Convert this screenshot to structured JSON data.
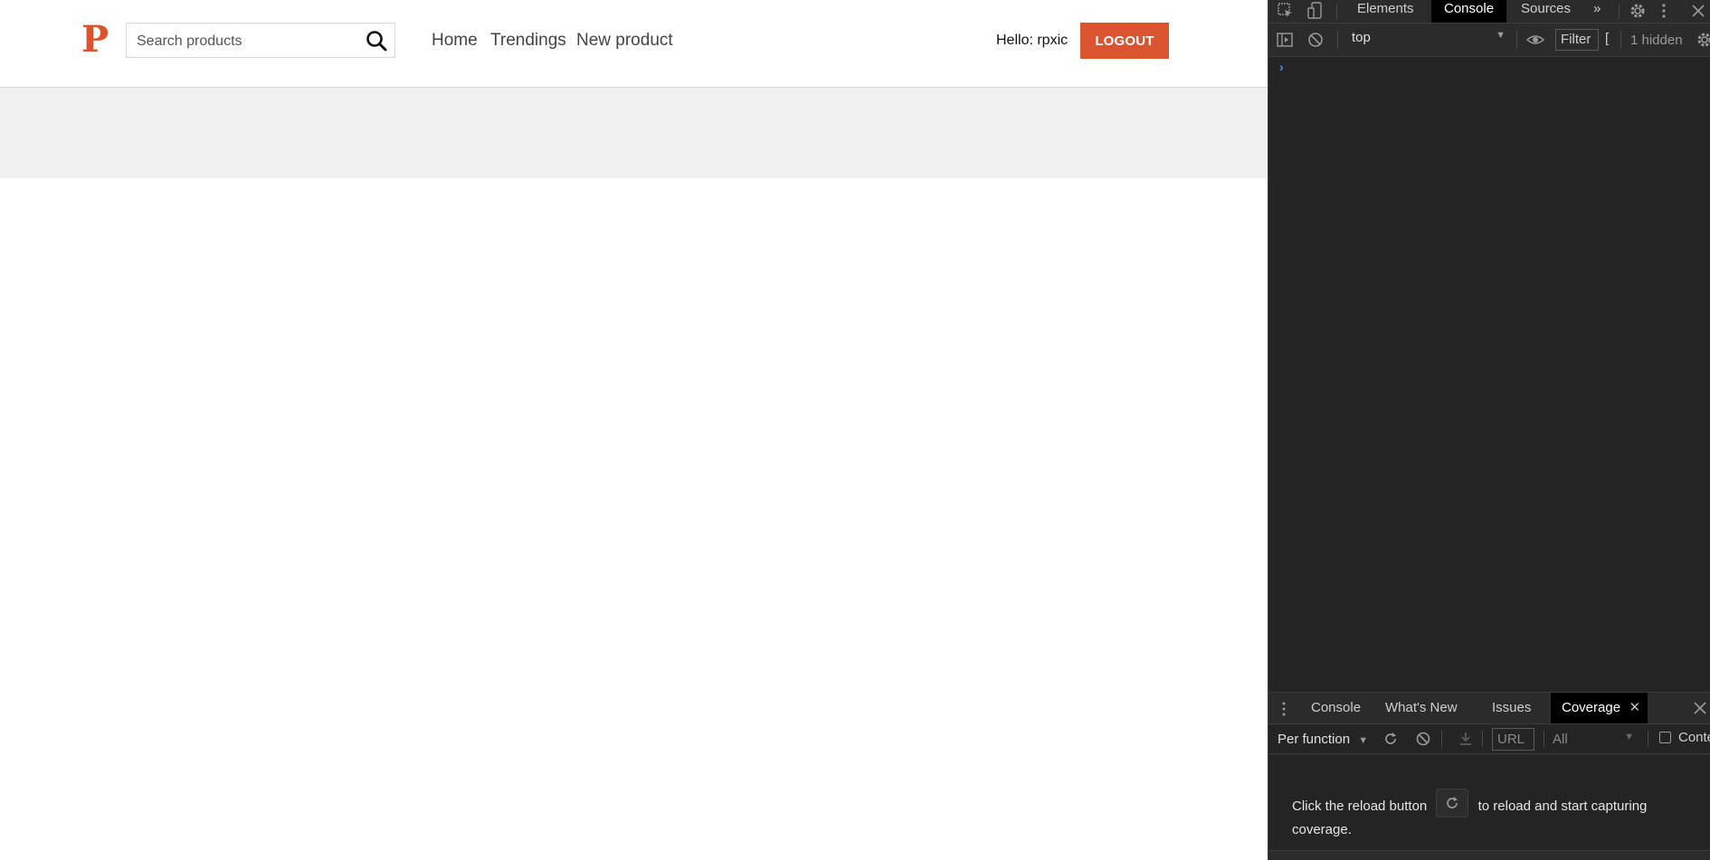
{
  "header": {
    "logo_letter": "P",
    "search_placeholder": "Search products",
    "nav": [
      "Home",
      "Trendings",
      "New product"
    ],
    "greeting": "Hello: rpxic",
    "logout_label": "LOGOUT"
  },
  "colors": {
    "brand": "#da552f",
    "banner": "#f0f0f0",
    "devtools_bg": "#242424"
  },
  "devtools": {
    "tabs": [
      "Elements",
      "Console",
      "Sources"
    ],
    "active_tab": "Console",
    "more_tabs_glyph": "»",
    "context": "top",
    "filter_label": "Filter",
    "filter_cursor": "[",
    "hidden_count": "1 hidden",
    "prompt_glyph": "›",
    "drawer": {
      "tabs": [
        "Console",
        "What's New",
        "Issues",
        "Coverage"
      ],
      "active_tab": "Coverage",
      "per_function": "Per function",
      "url_placeholder": "URL",
      "type_filter": "All",
      "content_label": "Conte",
      "message_before": "Click the reload button",
      "message_after": "to reload and start capturing coverage."
    }
  }
}
